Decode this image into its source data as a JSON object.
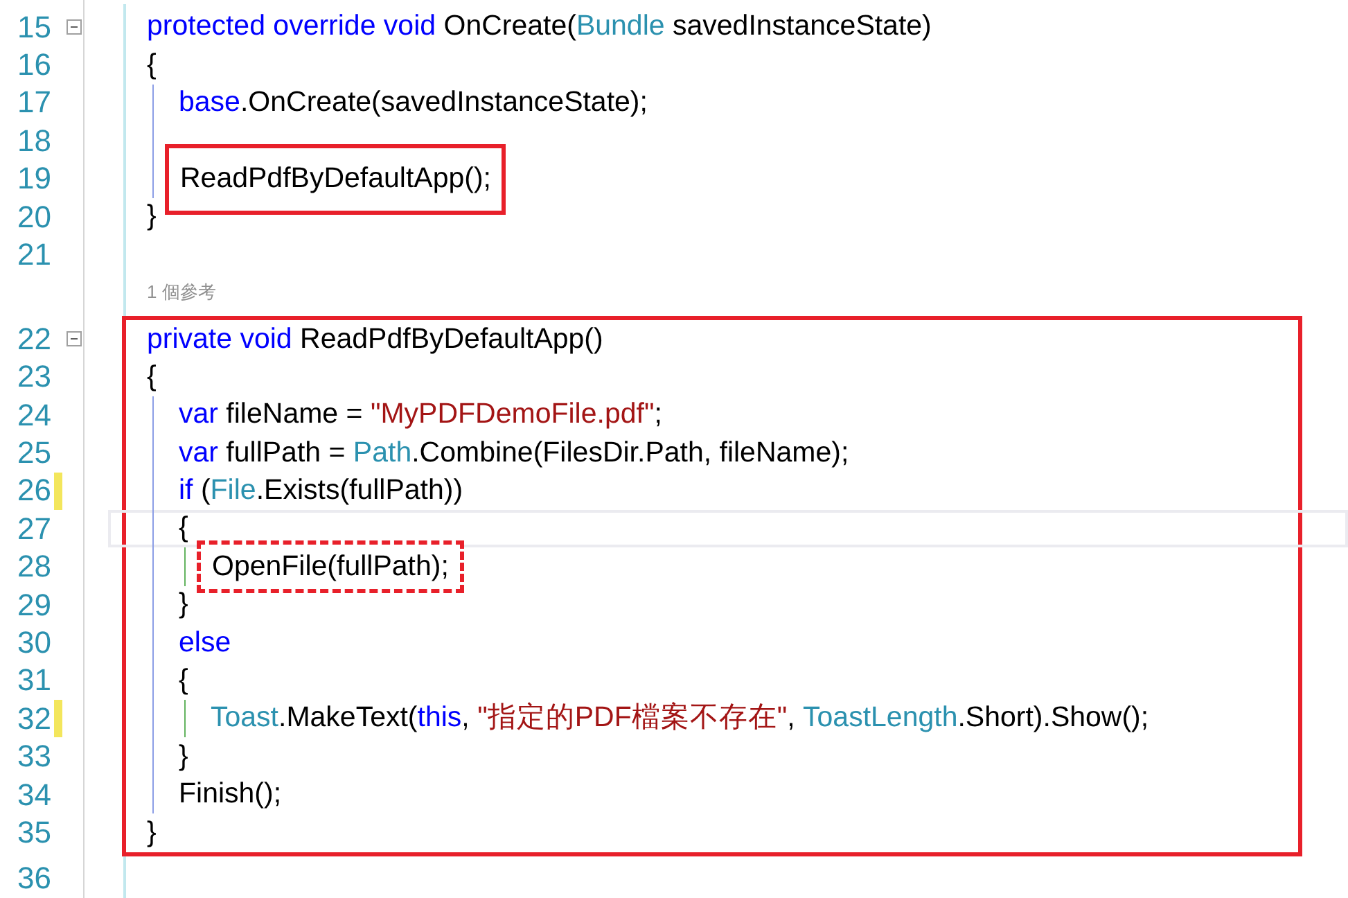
{
  "sections": [
    {
      "items": [
        {
          "kind": "line",
          "number": "15",
          "fold": true,
          "tokens": [
            {
              "kind": "keyword",
              "text": "protected override void"
            },
            {
              "kind": "plain",
              "text": " OnCreate("
            },
            {
              "kind": "type",
              "text": "Bundle"
            },
            {
              "kind": "plain",
              "text": " savedInstanceState)"
            }
          ]
        },
        {
          "kind": "line",
          "number": "16",
          "tokens": [
            {
              "kind": "plain",
              "text": "{"
            }
          ]
        },
        {
          "kind": "block",
          "children": [
            {
              "kind": "line",
              "number": "17",
              "tokens": [
                {
                  "kind": "keyword",
                  "text": "base"
                },
                {
                  "kind": "plain",
                  "text": ".OnCreate(savedInstanceState);"
                }
              ]
            },
            {
              "kind": "line",
              "number": "18"
            },
            {
              "kind": "line",
              "number": "19",
              "boxed": true,
              "tokens": [
                {
                  "kind": "plain",
                  "text": "ReadPdfByDefaultApp();"
                }
              ]
            }
          ]
        },
        {
          "kind": "line",
          "number": "20",
          "tokens": [
            {
              "kind": "plain",
              "text": "}"
            }
          ]
        },
        {
          "kind": "line",
          "number": "21"
        },
        {
          "kind": "codelens",
          "text": "1 個參考"
        }
      ]
    },
    {
      "boxed": true,
      "items": [
        {
          "kind": "line",
          "number": "22",
          "fold": true,
          "tokens": [
            {
              "kind": "keyword",
              "text": "private void"
            },
            {
              "kind": "plain",
              "text": " ReadPdfByDefaultApp()"
            }
          ]
        },
        {
          "kind": "line",
          "number": "23",
          "tokens": [
            {
              "kind": "plain",
              "text": "{"
            }
          ]
        },
        {
          "kind": "block",
          "children": [
            {
              "kind": "line",
              "number": "24",
              "tokens": [
                {
                  "kind": "keyword",
                  "text": "var"
                },
                {
                  "kind": "plain",
                  "text": " fileName = "
                },
                {
                  "kind": "string",
                  "text": "\"MyPDFDemoFile.pdf\""
                },
                {
                  "kind": "plain",
                  "text": ";"
                }
              ]
            },
            {
              "kind": "line",
              "number": "25",
              "tokens": [
                {
                  "kind": "keyword",
                  "text": "var"
                },
                {
                  "kind": "plain",
                  "text": " fullPath = "
                },
                {
                  "kind": "type",
                  "text": "Path"
                },
                {
                  "kind": "plain",
                  "text": ".Combine(FilesDir.Path, fileName);"
                }
              ]
            },
            {
              "kind": "line",
              "number": "26",
              "modified": true,
              "tokens": [
                {
                  "kind": "keyword",
                  "text": "if"
                },
                {
                  "kind": "plain",
                  "text": " ("
                },
                {
                  "kind": "type",
                  "text": "File"
                },
                {
                  "kind": "plain",
                  "text": ".Exists(fullPath))"
                }
              ]
            },
            {
              "kind": "line",
              "number": "27",
              "current": true,
              "tokens": [
                {
                  "kind": "plain",
                  "text": "{"
                }
              ]
            },
            {
              "kind": "block",
              "children": [
                {
                  "kind": "line",
                  "number": "28",
                  "boxed": true,
                  "dashed": true,
                  "tokens": [
                    {
                      "kind": "plain",
                      "text": "OpenFile(fullPath);"
                    }
                  ]
                }
              ]
            },
            {
              "kind": "line",
              "number": "29",
              "tokens": [
                {
                  "kind": "plain",
                  "text": "}"
                }
              ]
            },
            {
              "kind": "line",
              "number": "30",
              "tokens": [
                {
                  "kind": "keyword",
                  "text": "else"
                }
              ]
            },
            {
              "kind": "line",
              "number": "31",
              "tokens": [
                {
                  "kind": "plain",
                  "text": "{"
                }
              ]
            },
            {
              "kind": "block",
              "children": [
                {
                  "kind": "line",
                  "number": "32",
                  "modified": true,
                  "tokens": [
                    {
                      "kind": "type",
                      "text": "Toast"
                    },
                    {
                      "kind": "plain",
                      "text": ".MakeText("
                    },
                    {
                      "kind": "keyword",
                      "text": "this"
                    },
                    {
                      "kind": "plain",
                      "text": ", "
                    },
                    {
                      "kind": "string",
                      "text": "\"指定的PDF檔案不存在\""
                    },
                    {
                      "kind": "plain",
                      "text": ", "
                    },
                    {
                      "kind": "type",
                      "text": "ToastLength"
                    },
                    {
                      "kind": "plain",
                      "text": ".Short).Show();"
                    }
                  ]
                }
              ]
            },
            {
              "kind": "line",
              "number": "33",
              "tokens": [
                {
                  "kind": "plain",
                  "text": "}"
                }
              ]
            },
            {
              "kind": "line",
              "number": "34",
              "tokens": [
                {
                  "kind": "plain",
                  "text": "Finish();"
                }
              ]
            }
          ]
        },
        {
          "kind": "line",
          "number": "35",
          "tokens": [
            {
              "kind": "plain",
              "text": "}"
            }
          ]
        }
      ]
    },
    {
      "items": [
        {
          "kind": "line",
          "number": "36"
        }
      ]
    }
  ]
}
